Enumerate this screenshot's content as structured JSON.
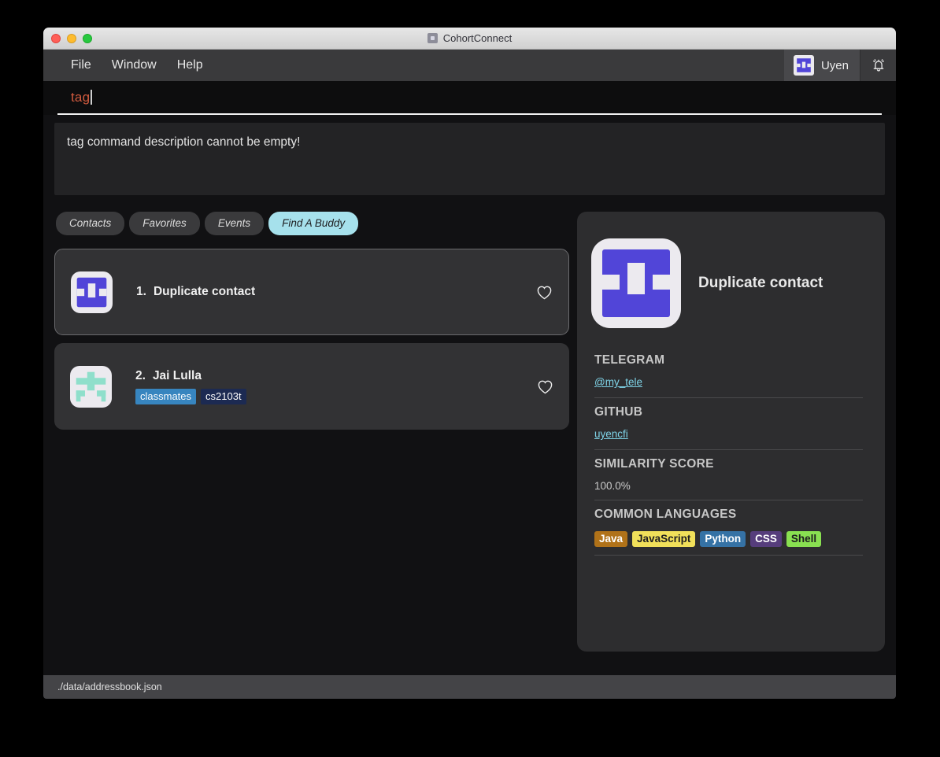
{
  "window": {
    "title": "CohortConnect",
    "title_icon": "app-icon",
    "traffic_lights": [
      "close",
      "minimize",
      "maximize"
    ]
  },
  "menubar": {
    "items": [
      "File",
      "Window",
      "Help"
    ],
    "user": {
      "name": "Uyen",
      "avatar_icon": "identicon-avatar"
    },
    "bell_icon": "notification-bell-icon"
  },
  "command": {
    "value": "tag",
    "text_color": "#d05a3e"
  },
  "result": {
    "message": "tag command description cannot be empty!"
  },
  "tabs": [
    {
      "label": "Contacts",
      "active": false
    },
    {
      "label": "Favorites",
      "active": false
    },
    {
      "label": "Events",
      "active": false
    },
    {
      "label": "Find A Buddy",
      "active": true
    }
  ],
  "contacts": [
    {
      "index": "1.",
      "name": "Duplicate contact",
      "tags": [],
      "selected": true,
      "favorite_icon": "heart-outline-icon",
      "avatar_color": "#5145d8"
    },
    {
      "index": "2.",
      "name": "Jai Lulla",
      "tags": [
        {
          "label": "classmates",
          "color": "#3785bf"
        },
        {
          "label": "cs2103t",
          "color": "#1c2a52"
        }
      ],
      "selected": false,
      "favorite_icon": "heart-outline-icon",
      "avatar_color": "#8fdfcb"
    }
  ],
  "detail": {
    "name": "Duplicate contact",
    "avatar_icon": "identicon-avatar",
    "fields": [
      {
        "label": "TELEGRAM",
        "value": "@my_tele",
        "type": "link"
      },
      {
        "label": "GITHUB",
        "value": "uyencfi",
        "type": "link"
      },
      {
        "label": "SIMILARITY SCORE",
        "value": "100.0%",
        "type": "text"
      }
    ],
    "languages_label": "COMMON LANGUAGES",
    "languages": [
      {
        "name": "Java",
        "color": "#b07219"
      },
      {
        "name": "JavaScript",
        "color": "#f1e05a",
        "text_color": "#1d1d1f"
      },
      {
        "name": "Python",
        "color": "#3572A5"
      },
      {
        "name": "CSS",
        "color": "#563d7c"
      },
      {
        "name": "Shell",
        "color": "#89e051",
        "text_color": "#1d1d1f"
      }
    ]
  },
  "statusbar": {
    "path": "./data/addressbook.json"
  }
}
